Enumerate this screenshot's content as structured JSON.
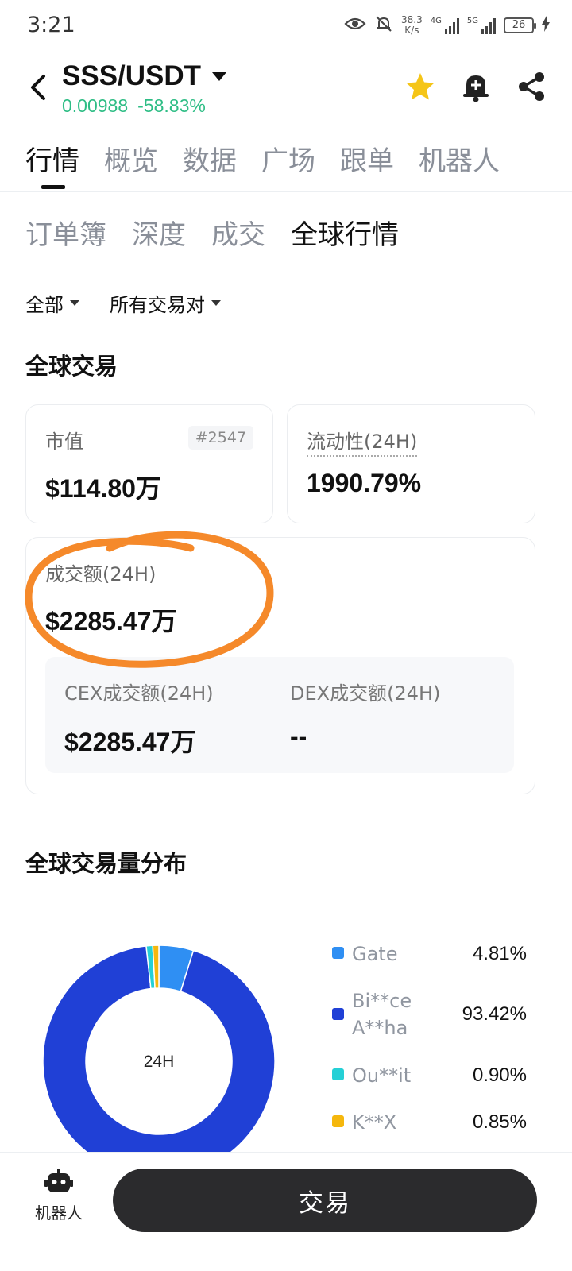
{
  "status_bar": {
    "time": "3:21",
    "net_speed_value": "38.3",
    "net_speed_unit": "K/s",
    "signal_1_label": "4G",
    "signal_2_label": "5G",
    "battery": "26"
  },
  "header": {
    "pair": "SSS/USDT",
    "price": "0.00988",
    "change": "-58.83%",
    "icons": [
      "back-arrow-icon",
      "star-icon",
      "bell-plus-icon",
      "share-icon"
    ],
    "price_color": "#2ebd85",
    "star_color": "#f5c518"
  },
  "main_tabs": [
    "行情",
    "概览",
    "数据",
    "广场",
    "跟单",
    "机器人"
  ],
  "main_tab_active": "行情",
  "sub_tabs": [
    "订单簿",
    "深度",
    "成交",
    "全球行情"
  ],
  "sub_tab_active": "全球行情",
  "filters": {
    "scope": "全部",
    "pairs": "所有交易对"
  },
  "global_trade": {
    "title": "全球交易",
    "market_cap_label": "市值",
    "market_cap_rank": "#2547",
    "market_cap_value": "$114.80万",
    "liquidity_label": "流动性(24H)",
    "liquidity_value": "1990.79%",
    "volume_label": "成交额(24H)",
    "volume_value": "$2285.47万",
    "cex_label": "CEX成交额(24H)",
    "cex_value": "$2285.47万",
    "dex_label": "DEX成交额(24H)",
    "dex_value": "--"
  },
  "distribution": {
    "title": "全球交易量分布",
    "center_label": "24H"
  },
  "chart_data": {
    "type": "pie",
    "title": "全球交易量分布",
    "slices": [
      {
        "name": "Gate",
        "value": 4.81,
        "color": "#2f8ff3"
      },
      {
        "name": "Bi**ce A**ha",
        "value": 93.42,
        "color": "#2040d6"
      },
      {
        "name": "Ou**it",
        "value": 0.9,
        "color": "#25d0d6"
      },
      {
        "name": "K**X",
        "value": 0.85,
        "color": "#f5b70d"
      }
    ],
    "legend_placement": "right"
  },
  "legend": [
    {
      "name_line1": "Gate",
      "name_line2": "",
      "pct": "4.81%",
      "color": "#2f8ff3"
    },
    {
      "name_line1": "Bi**ce",
      "name_line2": "A**ha",
      "pct": "93.42%",
      "color": "#2040d6"
    },
    {
      "name_line1": "Ou**it",
      "name_line2": "",
      "pct": "0.90%",
      "color": "#25d0d6"
    },
    {
      "name_line1": "K**X",
      "name_line2": "",
      "pct": "0.85%",
      "color": "#f5b70d"
    }
  ],
  "bottom_bar": {
    "robot_label": "机器人",
    "trade_label": "交易"
  },
  "annotation_color": "#f5892a"
}
